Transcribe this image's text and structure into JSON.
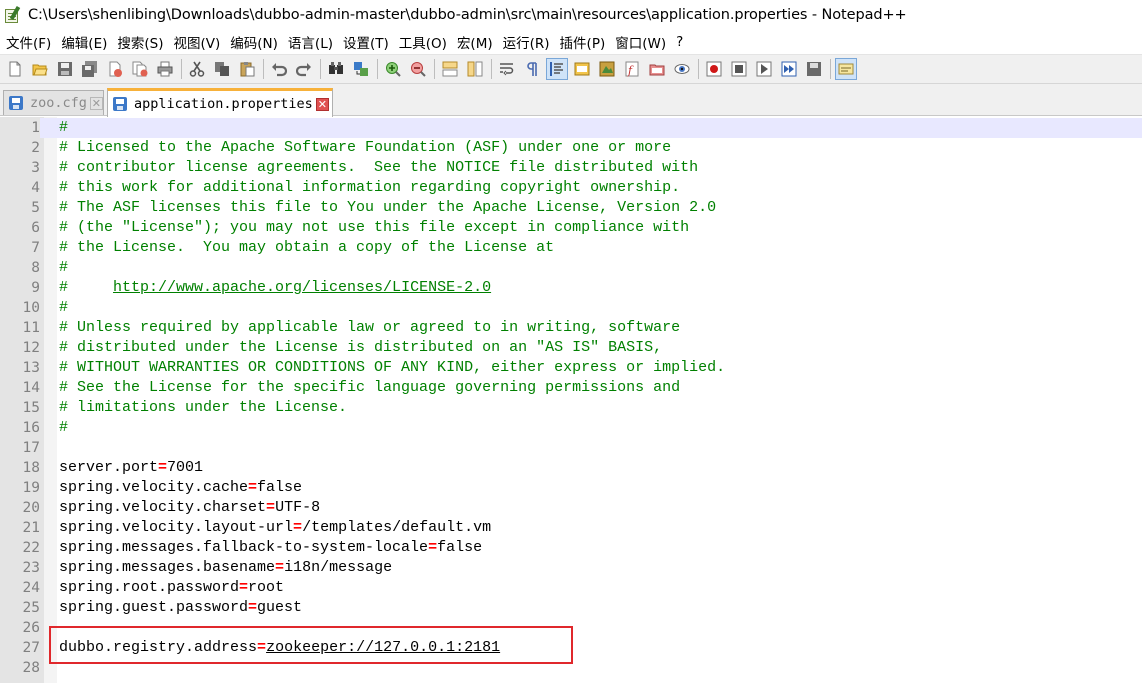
{
  "window": {
    "title": "C:\\Users\\shenlibing\\Downloads\\dubbo-admin-master\\dubbo-admin\\src\\main\\resources\\application.properties - Notepad++"
  },
  "menu": [
    "文件(F)",
    "编辑(E)",
    "搜索(S)",
    "视图(V)",
    "编码(N)",
    "语言(L)",
    "设置(T)",
    "工具(O)",
    "宏(M)",
    "运行(R)",
    "插件(P)",
    "窗口(W)",
    "?"
  ],
  "toolbar": {
    "buttons": [
      {
        "name": "new-file-icon"
      },
      {
        "name": "open-file-icon"
      },
      {
        "name": "save-icon"
      },
      {
        "name": "save-all-icon"
      },
      {
        "name": "close-icon"
      },
      {
        "name": "close-all-icon"
      },
      {
        "name": "print-icon"
      },
      {
        "name": "cut-icon"
      },
      {
        "name": "copy-icon"
      },
      {
        "name": "paste-icon"
      },
      {
        "name": "undo-icon"
      },
      {
        "name": "redo-icon"
      },
      {
        "name": "find-icon"
      },
      {
        "name": "replace-icon"
      },
      {
        "name": "zoom-in-icon"
      },
      {
        "name": "zoom-out-icon"
      },
      {
        "name": "sync-vertical-icon"
      },
      {
        "name": "sync-horizontal-icon"
      },
      {
        "name": "word-wrap-icon"
      },
      {
        "name": "show-all-chars-icon"
      },
      {
        "name": "indent-guide-icon"
      },
      {
        "name": "user-language-icon"
      },
      {
        "name": "document-map-icon"
      },
      {
        "name": "function-list-icon"
      },
      {
        "name": "folder-workspace-icon"
      },
      {
        "name": "monitoring-icon"
      },
      {
        "name": "record-macro-icon"
      },
      {
        "name": "stop-macro-icon"
      },
      {
        "name": "play-macro-icon"
      },
      {
        "name": "run-macro-multiple-icon"
      },
      {
        "name": "save-macro-icon"
      },
      {
        "name": "spell-check-icon"
      }
    ]
  },
  "tabs": [
    {
      "label": "zoo.cfg",
      "active": false
    },
    {
      "label": "application.properties",
      "active": true
    }
  ],
  "editor": {
    "current_line": 1,
    "highlighted_line": 27,
    "lines": [
      {
        "n": "1",
        "type": "comment",
        "text": "#"
      },
      {
        "n": "2",
        "type": "comment",
        "text": "# Licensed to the Apache Software Foundation (ASF) under one or more"
      },
      {
        "n": "3",
        "type": "comment",
        "text": "# contributor license agreements.  See the NOTICE file distributed with"
      },
      {
        "n": "4",
        "type": "comment",
        "text": "# this work for additional information regarding copyright ownership."
      },
      {
        "n": "5",
        "type": "comment",
        "text": "# The ASF licenses this file to You under the Apache License, Version 2.0"
      },
      {
        "n": "6",
        "type": "comment",
        "text": "# (the \"License\"); you may not use this file except in compliance with"
      },
      {
        "n": "7",
        "type": "comment",
        "text": "# the License.  You may obtain a copy of the License at"
      },
      {
        "n": "8",
        "type": "comment",
        "text": "#"
      },
      {
        "n": "9",
        "type": "comment-url",
        "prefix": "#     ",
        "url": "http://www.apache.org/licenses/LICENSE-2.0"
      },
      {
        "n": "10",
        "type": "comment",
        "text": "#"
      },
      {
        "n": "11",
        "type": "comment",
        "text": "# Unless required by applicable law or agreed to in writing, software"
      },
      {
        "n": "12",
        "type": "comment",
        "text": "# distributed under the License is distributed on an \"AS IS\" BASIS,"
      },
      {
        "n": "13",
        "type": "comment",
        "text": "# WITHOUT WARRANTIES OR CONDITIONS OF ANY KIND, either express or implied."
      },
      {
        "n": "14",
        "type": "comment",
        "text": "# See the License for the specific language governing permissions and"
      },
      {
        "n": "15",
        "type": "comment",
        "text": "# limitations under the License."
      },
      {
        "n": "16",
        "type": "comment",
        "text": "#"
      },
      {
        "n": "17",
        "type": "blank",
        "text": ""
      },
      {
        "n": "18",
        "type": "prop",
        "key": "server.port",
        "value": "7001"
      },
      {
        "n": "19",
        "type": "prop",
        "key": "spring.velocity.cache",
        "value": "false"
      },
      {
        "n": "20",
        "type": "prop",
        "key": "spring.velocity.charset",
        "value": "UTF-8"
      },
      {
        "n": "21",
        "type": "prop",
        "key": "spring.velocity.layout-url",
        "value": "/templates/default.vm"
      },
      {
        "n": "22",
        "type": "prop",
        "key": "spring.messages.fallback-to-system-locale",
        "value": "false"
      },
      {
        "n": "23",
        "type": "prop",
        "key": "spring.messages.basename",
        "value": "i18n/message"
      },
      {
        "n": "24",
        "type": "prop",
        "key": "spring.root.password",
        "value": "root"
      },
      {
        "n": "25",
        "type": "prop",
        "key": "spring.guest.password",
        "value": "guest"
      },
      {
        "n": "26",
        "type": "blank",
        "text": ""
      },
      {
        "n": "27",
        "type": "prop-link",
        "key": "dubbo.registry.address",
        "value": "zookeeper://127.0.0.1:2181"
      },
      {
        "n": "28",
        "type": "blank",
        "text": ""
      }
    ]
  },
  "colors": {
    "comment": "#008000",
    "operator": "#ff0000",
    "current_line": "#e8e8ff",
    "annotation_box": "#e0282c"
  }
}
